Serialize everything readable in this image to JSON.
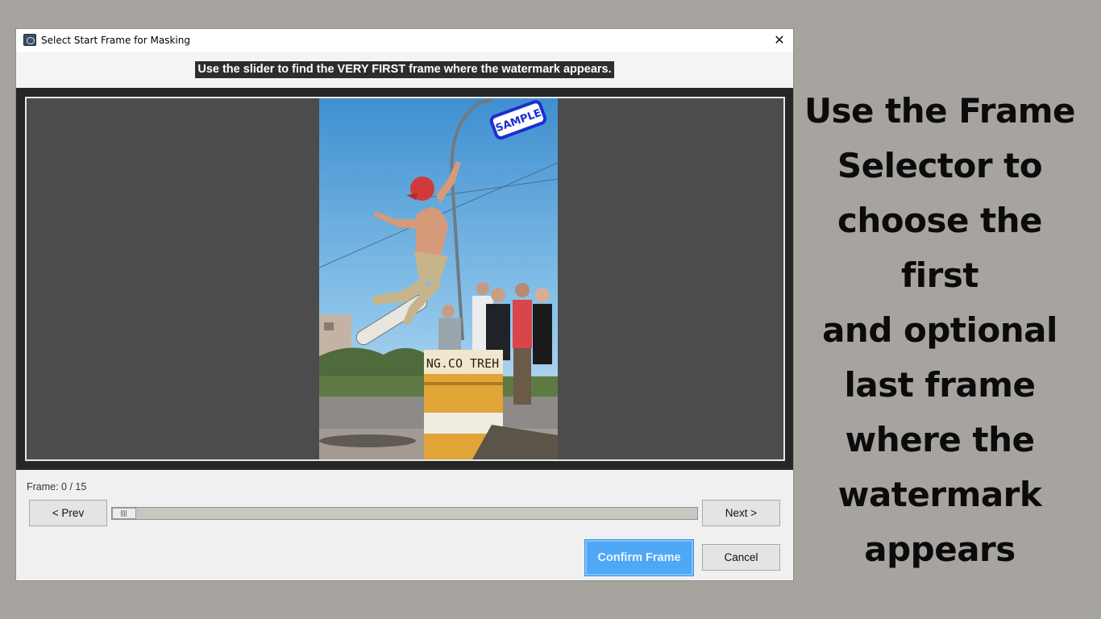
{
  "dialog": {
    "title": "Select Start Frame for Masking",
    "close_glyph": "✕",
    "instruction": "Use the slider to find the VERY FIRST frame where the watermark appears.",
    "preview": {
      "watermark_text": "SAMPLE",
      "barrel_text": "NG.CO TREH"
    },
    "frame_label": "Frame: 0 / 15",
    "prev_label": "< Prev",
    "next_label": "Next >",
    "slider": {
      "value": 0,
      "max": 15
    },
    "confirm_label": "Confirm Frame",
    "cancel_label": "Cancel"
  },
  "caption": {
    "lines": [
      "Use the Frame",
      "Selector to",
      "choose the first",
      "and optional",
      "last frame",
      "where the",
      "watermark",
      "appears"
    ]
  },
  "colors": {
    "background": "#a7a39f",
    "confirm_button": "#4fa8f5",
    "watermark_stamp": "#1a2fd0",
    "preview_bg": "#4c4c4c"
  },
  "icons": {
    "app": "app-window-icon",
    "close": "close-icon",
    "slider_grip": "grip-icon"
  }
}
